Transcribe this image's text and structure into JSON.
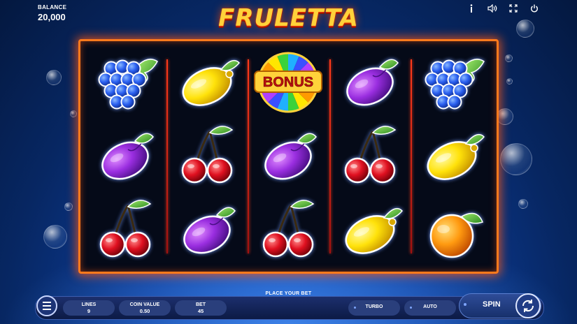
{
  "header": {
    "balance_label": "BALANCE",
    "balance_value": "20,000",
    "title": "FRULETTA",
    "icons": [
      "info-icon",
      "sound-icon",
      "fullscreen-icon",
      "power-icon"
    ]
  },
  "reels": [
    [
      "grapes",
      "plum",
      "cherries"
    ],
    [
      "lemon",
      "cherries",
      "plum"
    ],
    [
      "bonus",
      "plum",
      "cherries"
    ],
    [
      "plum",
      "cherries",
      "lemon"
    ],
    [
      "grapes",
      "lemon",
      "orange"
    ]
  ],
  "bonus_label": "BONUS",
  "footer": {
    "prompt": "PLACE YOUR BET",
    "lines_label": "LINES",
    "lines_value": "9",
    "coin_value_label": "COIN VALUE",
    "coin_value": "0.50",
    "bet_label": "BET",
    "bet_value": "45",
    "turbo_label": "TURBO",
    "auto_label": "AUTO",
    "spin_label": "SPIN"
  },
  "colors": {
    "frame": "#ff7a1c",
    "title": "#ffd23a",
    "panel": "#1c2f6d"
  }
}
